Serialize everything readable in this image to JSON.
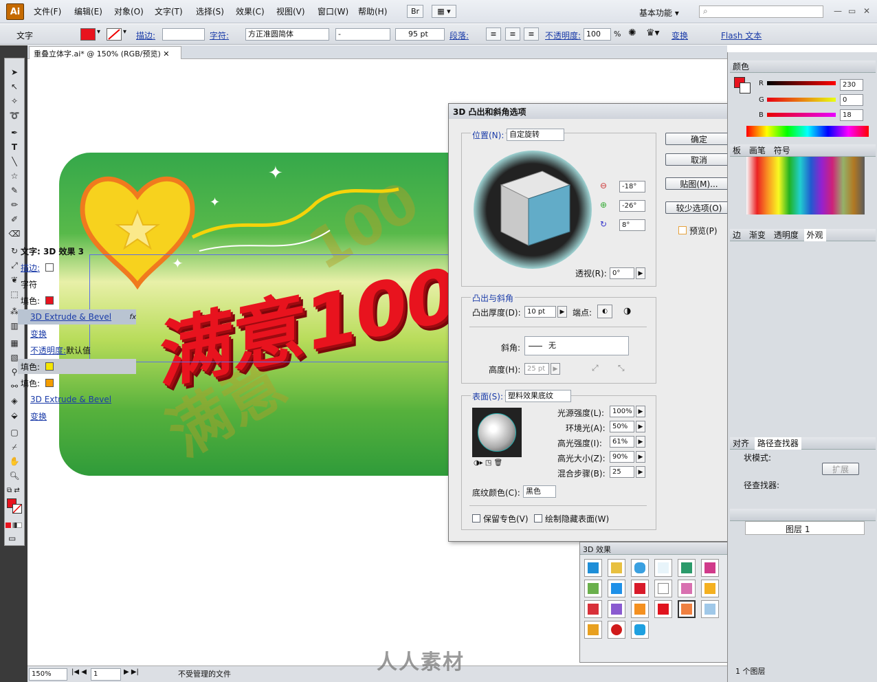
{
  "app": {
    "logo": "Ai"
  },
  "menu": {
    "items": [
      "文件(F)",
      "编辑(E)",
      "对象(O)",
      "文字(T)",
      "选择(S)",
      "效果(C)",
      "视图(V)",
      "窗口(W)",
      "帮助(H)"
    ],
    "br": "Br",
    "workspace": "基本功能"
  },
  "control": {
    "label": "文字",
    "stroke_link": "描边:",
    "char_link": "字符:",
    "font": "方正准圆简体",
    "style": "-",
    "size": "95 pt",
    "para_link": "段落:",
    "opacity_link": "不透明度:",
    "opacity": "100",
    "pct": "%",
    "transform_link": "变换",
    "flash_link": "Flash 文本"
  },
  "document": {
    "tab": "重叠立体字.ai* @ 150% (RGB/预览)"
  },
  "artwork": {
    "headline": "满意100"
  },
  "status": {
    "zoom": "150%",
    "page": "1",
    "info": "不受管理的文件"
  },
  "dialog": {
    "title": "3D 凸出和斜角选项",
    "position_label": "位置(N):",
    "position_value": "自定旋转",
    "rot_x": "-18°",
    "rot_y": "-26°",
    "rot_z": "8°",
    "perspective_label": "透视(R):",
    "perspective_value": "0°",
    "extrude_group": "凸出与斜角",
    "depth_label": "凸出厚度(D):",
    "depth_value": "10 pt",
    "cap_label": "端点:",
    "bevel_label": "斜角:",
    "bevel_value": "无",
    "height_label": "高度(H):",
    "height_value": "25 pt",
    "surface_label": "表面(S):",
    "surface_value": "塑料效果底纹",
    "light_intensity_label": "光源强度(L):",
    "light_intensity": "100%",
    "ambient_label": "环境光(A):",
    "ambient": "50%",
    "highlight_intensity_label": "高光强度(I):",
    "highlight_intensity": "61%",
    "highlight_size_label": "高光大小(Z):",
    "highlight_size": "90%",
    "blend_steps_label": "混合步骤(B):",
    "blend_steps": "25",
    "shading_color_label": "底纹颜色(C):",
    "shading_color": "黑色",
    "preserve_spot_label": "保留专色(V)",
    "draw_hidden_label": "绘制隐藏表面(W)",
    "ok": "确定",
    "cancel": "取消",
    "map_art": "贴图(M)...",
    "fewer": "较少选项(O)",
    "preview": "预览(P)"
  },
  "color_panel": {
    "title": "颜色",
    "r_label": "R",
    "r": "230",
    "g_label": "G",
    "g": "0",
    "b_label": "B",
    "b": "18"
  },
  "swatch_tabs": {
    "swatches": "板",
    "brushes": "画笔",
    "symbols": "符号"
  },
  "appearance": {
    "tabs": [
      "边",
      "渐变",
      "透明度",
      "外观"
    ],
    "header": "文字: 3D 效果 3",
    "stroke": "描边:",
    "characters": "字符",
    "fill": "填色:",
    "effect": "3D Extrude & Bevel",
    "transform": "变换",
    "opacity": "不透明度:",
    "opacity_value": "默认值",
    "fill2": "填色:",
    "fill3": "填色:",
    "effect2": "3D Extrude & Bevel",
    "transform2": "变换"
  },
  "pathfinder": {
    "tabs": [
      "对齐",
      "路径查找器"
    ],
    "shape_modes": "状模式:",
    "expand": "扩展",
    "pathfinders": "径查找器:"
  },
  "layers": {
    "layer": "图层 1",
    "count": "1 个图层"
  },
  "effects3d": {
    "title": "3D 效果"
  },
  "watermark": "人人素材",
  "colors": {
    "fill_red": "#e8131e",
    "yellow": "#f5e600",
    "orange": "#f49d00",
    "banner_green": "#35a84a"
  }
}
